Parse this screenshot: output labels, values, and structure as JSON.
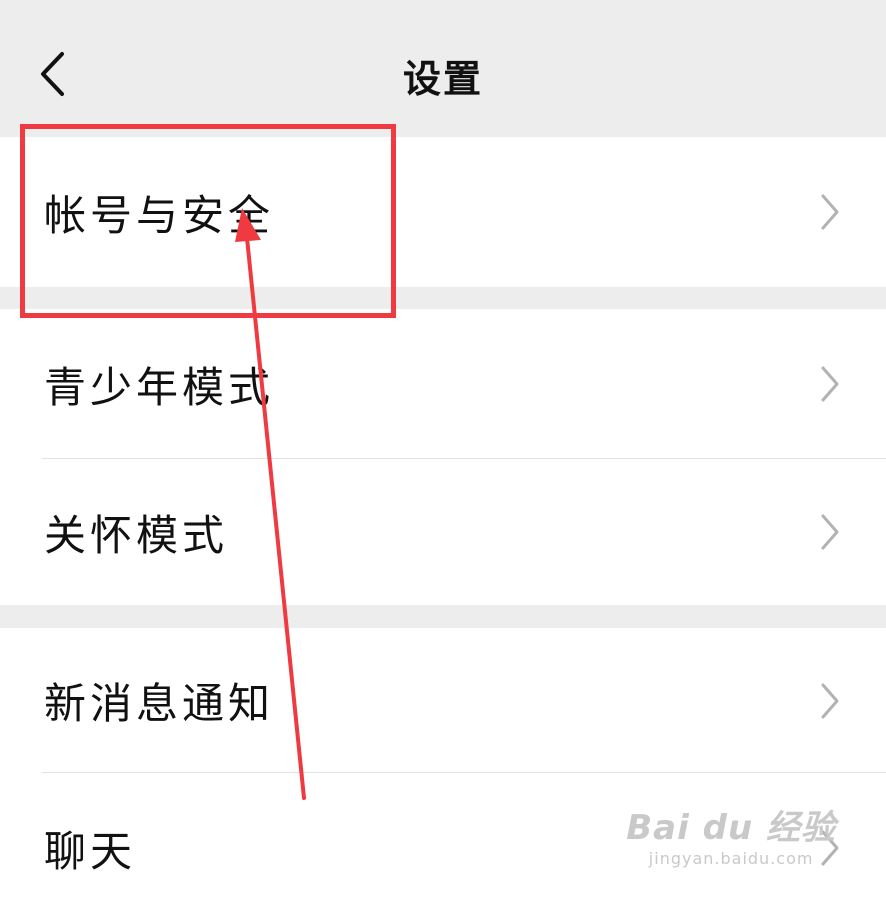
{
  "header": {
    "title": "设置",
    "back_icon": "chevron-left-icon"
  },
  "groups": [
    {
      "items": [
        {
          "label": "帐号与安全",
          "icon": "chevron-right-icon"
        }
      ]
    },
    {
      "items": [
        {
          "label": "青少年模式",
          "icon": "chevron-right-icon"
        },
        {
          "label": "关怀模式",
          "icon": "chevron-right-icon"
        }
      ]
    },
    {
      "items": [
        {
          "label": "新消息通知",
          "icon": "chevron-right-icon"
        },
        {
          "label": "聊天",
          "icon": "chevron-right-icon"
        }
      ]
    }
  ],
  "annotation": {
    "box_color": "#ee3a40",
    "arrow_color": "#ee3a40"
  },
  "watermark": {
    "logo": "Bai du 经验",
    "url": "jingyan.baidu.com"
  },
  "colors": {
    "background": "#ededed",
    "row_background": "#ffffff",
    "chevron": "#b2b2b2"
  }
}
